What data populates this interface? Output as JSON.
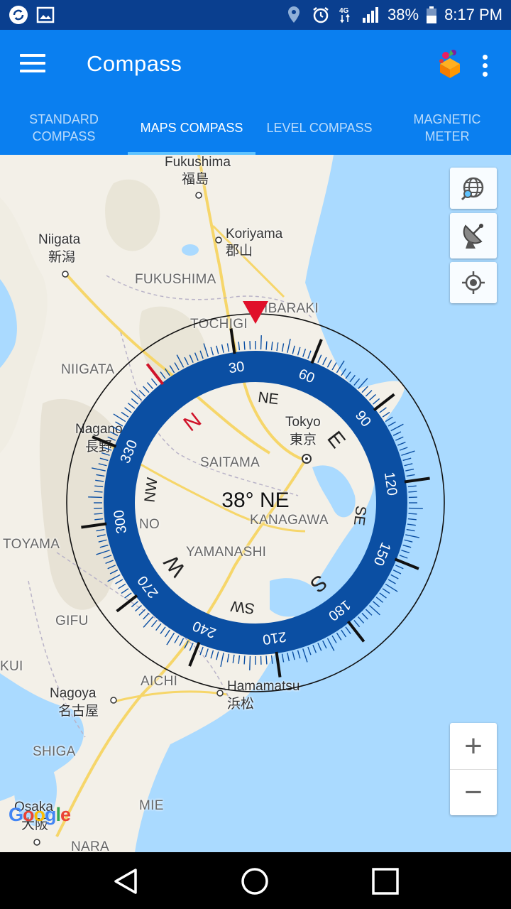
{
  "status_bar": {
    "icons_left": [
      "sync-icon",
      "image-icon"
    ],
    "icons_right": [
      "location-icon",
      "alarm-icon",
      "4g-icon",
      "signal-icon"
    ],
    "network": "4G",
    "battery": "38%",
    "time": "8:17 PM"
  },
  "app_bar": {
    "title": "Compass",
    "menu_icon": "hamburger-icon",
    "promo_icon": "gift-icon",
    "overflow_icon": "more-vert-icon"
  },
  "tabs": [
    {
      "label_line1": "STANDARD",
      "label_line2": "COMPASS",
      "active": false
    },
    {
      "label_line1": "MAPS COMPASS",
      "label_line2": "",
      "active": true
    },
    {
      "label_line1": "LEVEL COMPASS",
      "label_line2": "",
      "active": false
    },
    {
      "label_line1": "MAGNETIC",
      "label_line2": "METER",
      "active": false
    }
  ],
  "map": {
    "labels": {
      "fukushima_en": "Fukushima",
      "fukushima_jp": "福島",
      "koriyama_en": "Koriyama",
      "koriyama_jp": "郡山",
      "niigata_en": "Niigata",
      "niigata_jp": "新潟",
      "fukushima_pref": "FUKUSHIMA",
      "ibaraki": "IBARAKI",
      "tochigi": "TOCHIGI",
      "niigata_pref": "NIIGATA",
      "nagano": "Nagano",
      "nagano_jp": "長野",
      "tokyo_en": "Tokyo",
      "tokyo_jp": "東京",
      "saitama": "SAITAMA",
      "kanagawa": "KANAGAWA",
      "toyama": "TOYAMA",
      "yamanashi": "YAMANASHI",
      "gifu": "GIFU",
      "aichi": "AICHI",
      "hamamatsu_en": "Hamamatsu",
      "hamamatsu_jp": "浜松",
      "nagoya_en": "Nagoya",
      "nagoya_jp": "名古屋",
      "shiga": "SHIGA",
      "mie": "MIE",
      "osaka_en": "Osaka",
      "osaka_jp": "大阪",
      "nara": "NARA",
      "kui": "KUI",
      "no_fragment": "NO"
    },
    "buttons": {
      "globe_search": "globe-search-icon",
      "satellite": "satellite-dish-icon",
      "my_location": "my-location-icon",
      "zoom_in": "+",
      "zoom_out": "−"
    },
    "attribution": "Google"
  },
  "compass": {
    "heading_degrees": 38,
    "heading_text": "38° NE",
    "dial_labels": [
      "30",
      "60",
      "90",
      "120",
      "150",
      "180",
      "210",
      "240",
      "270",
      "300",
      "330"
    ],
    "cardinal_labels": [
      "N",
      "NE",
      "E",
      "SE",
      "S",
      "SW",
      "W",
      "NW"
    ],
    "colors": {
      "ring": "#0b4fa3",
      "north": "#d0132a",
      "marker": "#e0102a"
    }
  },
  "nav_bar": {
    "back": "back-icon",
    "home": "home-icon",
    "recents": "recents-icon"
  }
}
